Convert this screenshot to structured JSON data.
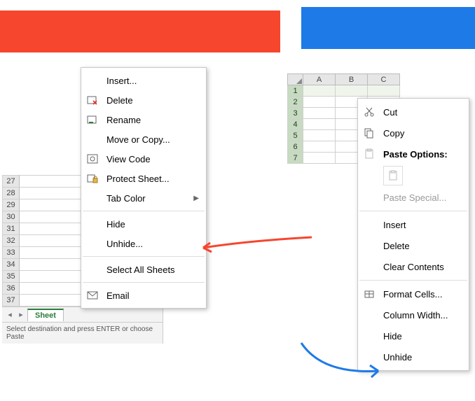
{
  "banners": {
    "red": "",
    "blue": ""
  },
  "left_sheet": {
    "rows": [
      "27",
      "28",
      "29",
      "30",
      "31",
      "32",
      "33",
      "34",
      "35",
      "36",
      "37"
    ],
    "tabs": {
      "active": "Sheet"
    },
    "status": "Select destination and press ENTER or choose Paste"
  },
  "sheet_tab_menu": {
    "insert": "Insert...",
    "delete": "Delete",
    "rename": "Rename",
    "move_or_copy": "Move or Copy...",
    "view_code": "View Code",
    "protect_sheet": "Protect Sheet...",
    "tab_color": "Tab Color",
    "hide": "Hide",
    "unhide": "Unhide...",
    "select_all_sheets": "Select All Sheets",
    "email": "Email"
  },
  "right_sheet": {
    "cols": [
      "A",
      "B",
      "C"
    ],
    "rows": [
      "1",
      "2",
      "3",
      "4",
      "5",
      "6",
      "7"
    ]
  },
  "row_menu": {
    "cut": "Cut",
    "copy": "Copy",
    "paste_options": "Paste Options:",
    "paste_special": "Paste Special...",
    "insert": "Insert",
    "delete": "Delete",
    "clear_contents": "Clear Contents",
    "format_cells": "Format Cells...",
    "column_width": "Column Width...",
    "hide": "Hide",
    "unhide": "Unhide"
  }
}
